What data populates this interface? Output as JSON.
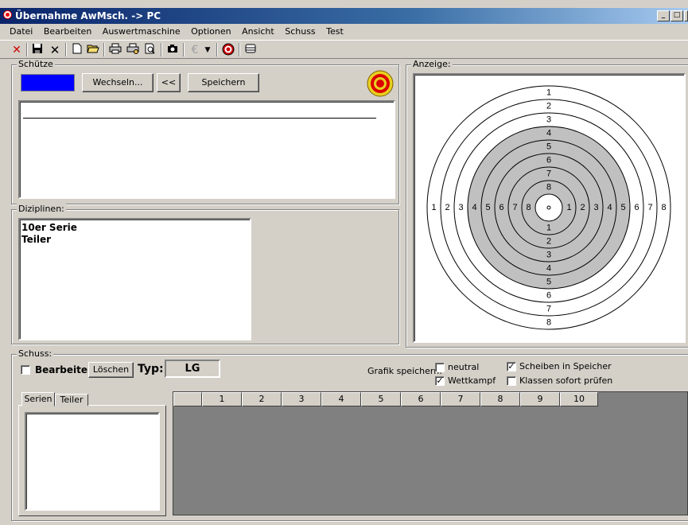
{
  "window": {
    "title": "Übernahme AwMsch. -> PC",
    "controls": [
      "_",
      "□",
      "×"
    ]
  },
  "menu": [
    {
      "label": "Datei"
    },
    {
      "label": "Bearbeiten"
    },
    {
      "label": "Auswertmaschine"
    },
    {
      "label": "Optionen"
    },
    {
      "label": "Ansicht"
    },
    {
      "label": "Schuss"
    },
    {
      "label": "Test"
    }
  ],
  "toolbar": {
    "icons": [
      "exit-icon",
      "save-icon",
      "close-icon",
      "new-icon",
      "open-icon",
      "print-icon",
      "print-setup-icon",
      "print-preview-icon",
      "camera-icon",
      "euro-icon",
      "dropdown-arrow-icon",
      "target-icon",
      "printer-small-icon"
    ],
    "euro_glyph": "€"
  },
  "schuetze": {
    "label": "Schütze",
    "color_swatch": "#0000ff",
    "wechseln_label": "Wechseln...",
    "back_label": "<<",
    "speichern_label": "Speichern"
  },
  "diziplinen": {
    "label": "Diziplinen:",
    "items": [
      "10er Serie",
      "Teiler"
    ]
  },
  "anzeige": {
    "label": "Anzeige:",
    "ring_numbers_top": [
      "1",
      "2",
      "3",
      "4",
      "5",
      "6",
      "7",
      "8"
    ],
    "ring_numbers_bottom": [
      "8",
      "7",
      "6",
      "5",
      "4",
      "3",
      "2",
      "1"
    ],
    "ring_numbers_left": [
      "1",
      "2",
      "3",
      "4",
      "5",
      "6",
      "7",
      "8"
    ],
    "ring_numbers_right": [
      "8",
      "7",
      "6",
      "5",
      "4",
      "3",
      "2",
      "1"
    ]
  },
  "schuss": {
    "label": "Schuss:",
    "bearbeiten_label": "Bearbeiten",
    "bearbeiten_checked": false,
    "loeschen_label": "Löschen",
    "typ_label": "Typ:",
    "typ_value": "LG",
    "grafik_label": "Grafik speichern:",
    "options": {
      "neutral": {
        "label": "neutral",
        "checked": false
      },
      "wettkampf": {
        "label": "Wettkampf",
        "checked": true
      },
      "scheiben": {
        "label": "Scheiben in Speicher",
        "checked": true
      },
      "klassen": {
        "label": "Klassen sofort prüfen",
        "checked": false
      }
    },
    "tabs": [
      "Serien",
      "Teiler"
    ],
    "grid_columns": [
      "1",
      "2",
      "3",
      "4",
      "5",
      "6",
      "7",
      "8",
      "9",
      "10"
    ]
  }
}
